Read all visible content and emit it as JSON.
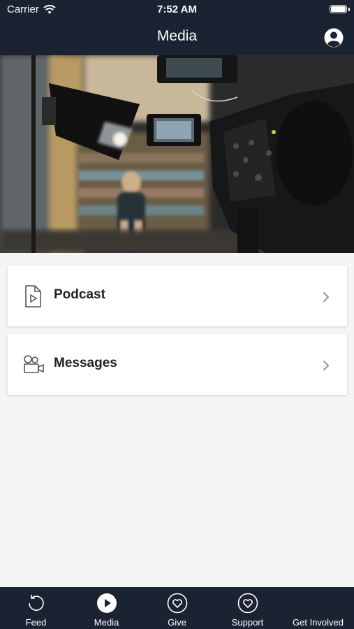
{
  "status_bar": {
    "carrier": "Carrier",
    "time": "7:52 AM"
  },
  "header": {
    "title": "Media",
    "profile_icon": "person-circle-icon"
  },
  "hero_image": {
    "subject": "video camera rig in front of bookshelf studio"
  },
  "menu": {
    "items": [
      {
        "label": "Podcast",
        "icon": "document-play-icon"
      },
      {
        "label": "Messages",
        "icon": "video-camera-icon"
      }
    ]
  },
  "tab_bar": {
    "items": [
      {
        "label": "Feed",
        "icon": "refresh-icon",
        "active": false
      },
      {
        "label": "Media",
        "icon": "play-circle-icon",
        "active": true
      },
      {
        "label": "Give",
        "icon": "heart-circle-icon",
        "active": false
      },
      {
        "label": "Support",
        "icon": "heart-circle-icon",
        "active": false
      },
      {
        "label": "Get Involved",
        "icon": "",
        "active": false
      }
    ]
  },
  "colors": {
    "bar_background": "#1b2232",
    "page_background": "#f5f5f5",
    "card_background": "#ffffff"
  }
}
